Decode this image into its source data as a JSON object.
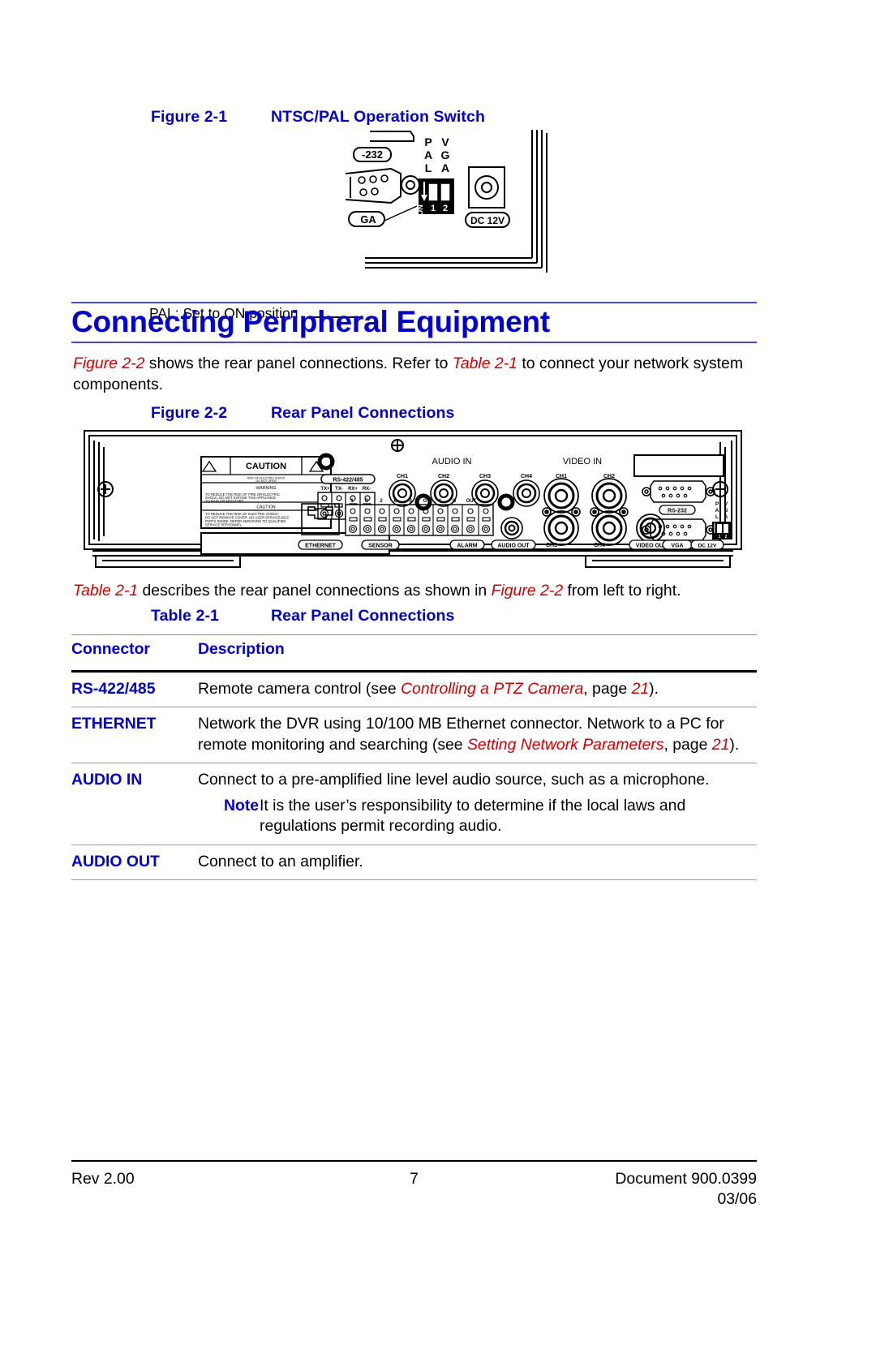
{
  "figure21": {
    "caption_number": "Figure 2-1",
    "caption_title": "NTSC/PAL Operation Switch",
    "callout": "PAL: Set to ON position",
    "art_labels": {
      "rs232": "-232",
      "vga": "GA",
      "dc": "DC 12V",
      "pal": "PAL",
      "vga_vert": "VGA",
      "on": "ON",
      "sw1": "1",
      "sw2": "2"
    }
  },
  "section": {
    "heading": "Connecting Peripheral Equipment",
    "para1": {
      "ref1": "Figure 2-2",
      "text1": " shows the rear panel connections. Refer to ",
      "ref2": "Table 2-1",
      "text2": " to connect your network system components."
    }
  },
  "figure22": {
    "caption_number": "Figure 2-2",
    "caption_title": "Rear Panel Connections",
    "panel_labels": {
      "caution_title": "CAUTION",
      "caution_sub": "RISK OF ELECTRIC SHOCK\nDO NOT OPEN",
      "warning": "WARNING",
      "warning_body": "TO REDUCE THE RISK OF FIRE OR ELECTRIC SHOCK, DO NOT EXPOSE THIS APPLIANCE TO RAIN OR MOISTURE.",
      "caution2": "CAUTION",
      "caution2_body": "TO REDUCE THE RISK OF ELECTRIC SHOCK, DO NOT REMOVE COVER. NO USER SERVICEABLE PARTS INSIDE. REFER SERVICING TO QUALIFIED SERVICE PERSONNEL.",
      "rs422": "RS-422/485",
      "rs422_pins": [
        "TX+",
        "TX-",
        "RX+",
        "RX-"
      ],
      "audio_in": "AUDIO IN",
      "video_in": "VIDEO IN",
      "audio_ch": [
        "CH1",
        "CH2",
        "CH3",
        "CH4"
      ],
      "video_ch_top": [
        "CH1",
        "CH2"
      ],
      "video_ch_bottom": [
        "CH3",
        "CH4"
      ],
      "terminal_pins": [
        "1",
        "G",
        "2",
        "G",
        "3",
        "G",
        "4",
        "G",
        "OUT",
        ""
      ],
      "ethernet": "ETHERNET",
      "sensor": "SENSOR",
      "alarm": "ALARM",
      "audio_out": "AUDIO OUT",
      "video_out": "VIDEO OUT",
      "vga": "VGA",
      "rs232": "RS-232",
      "dc12v": "DC 12V",
      "pal_label": "PAL",
      "vga_label": "VGA",
      "dip_on": "ON",
      "dip1": "1",
      "dip2": "2"
    }
  },
  "para2": {
    "ref1": "Table 2-1",
    "text1": " describes the rear panel connections as shown in ",
    "ref2": "Figure 2-2",
    "text2": " from left to right."
  },
  "table": {
    "caption_number": "Table 2-1",
    "caption_title": "Rear Panel Connections",
    "headers": [
      "Connector",
      "Description"
    ],
    "rows": [
      {
        "connector": "RS-422/485",
        "desc_parts": [
          {
            "t": "Remote camera control (see ",
            "style": "plain"
          },
          {
            "t": "Controlling a PTZ Camera",
            "style": "red-italic"
          },
          {
            "t": ", page ",
            "style": "plain"
          },
          {
            "t": "21",
            "style": "red-italic"
          },
          {
            "t": ").",
            "style": "plain"
          }
        ]
      },
      {
        "connector": "ETHERNET",
        "desc_parts": [
          {
            "t": "Network the DVR using 10/100 MB Ethernet connector. Network to a PC for remote monitoring and searching (see ",
            "style": "plain"
          },
          {
            "t": "Setting Network Parameters",
            "style": "red-italic"
          },
          {
            "t": ", page ",
            "style": "plain"
          },
          {
            "t": "21",
            "style": "red-italic"
          },
          {
            "t": ").",
            "style": "plain"
          }
        ]
      },
      {
        "connector": "AUDIO IN",
        "desc_parts": [
          {
            "t": "Connect to a pre-amplified line level audio source, such as a microphone.",
            "style": "plain"
          }
        ],
        "note_label": "Note",
        "note_text": "It is the user’s responsibility to determine if the local laws and regulations permit recording audio."
      },
      {
        "connector": "AUDIO OUT",
        "desc_parts": [
          {
            "t": "Connect to an amplifier.",
            "style": "plain"
          }
        ]
      }
    ]
  },
  "footer": {
    "left": "Rev 2.00",
    "center": "7",
    "right_line1": "Document 900.0399",
    "right_line2": "03/06"
  },
  "colors": {
    "heading_blue": "#0000d5",
    "rule_blue": "#4a4ad0",
    "ref_red": "#d00000"
  }
}
